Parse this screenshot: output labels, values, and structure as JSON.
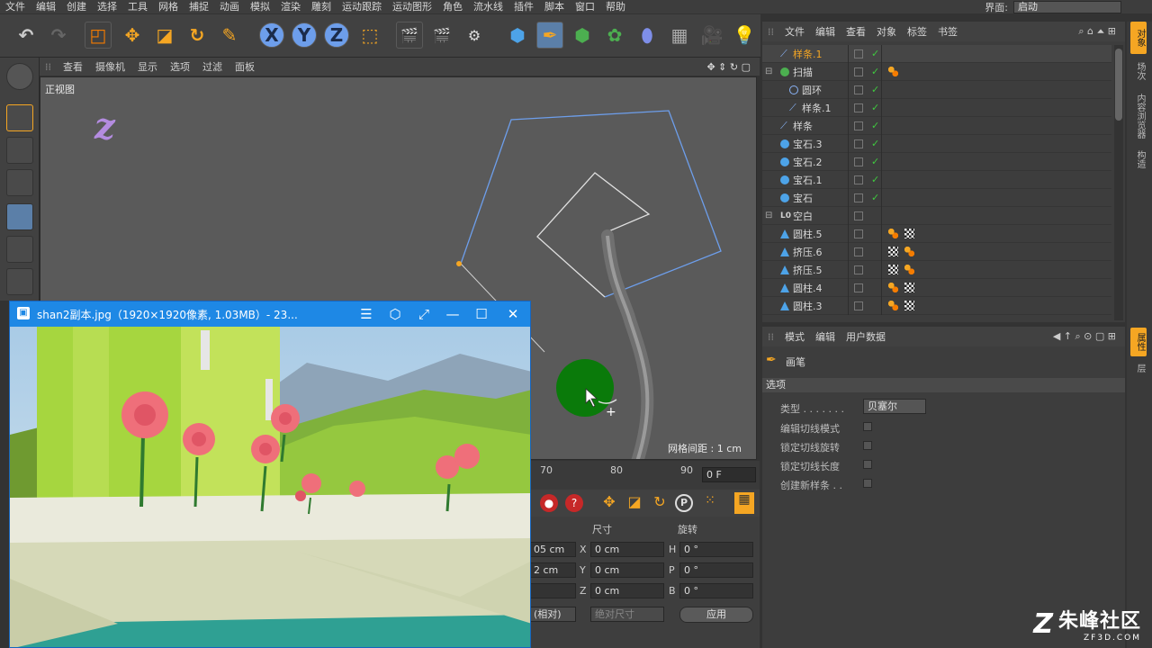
{
  "menubar": {
    "items": [
      "文件",
      "编辑",
      "创建",
      "选择",
      "工具",
      "网格",
      "捕捉",
      "动画",
      "模拟",
      "渲染",
      "雕刻",
      "运动跟踪",
      "运动图形",
      "角色",
      "流水线",
      "插件",
      "脚本",
      "窗口",
      "帮助"
    ],
    "interface_label": "界面:",
    "interface_value": "启动"
  },
  "viewport": {
    "menu": [
      "查看",
      "摄像机",
      "显示",
      "选项",
      "过滤",
      "面板"
    ],
    "view_name": "正视图",
    "grid_spacing": "网格间距 : 1 cm"
  },
  "timeline": {
    "ticks": [
      "70",
      "80",
      "90"
    ],
    "frame": "0 F"
  },
  "coords": {
    "headers": {
      "size": "尺寸",
      "rotation": "旋转"
    },
    "pos": [
      "05 cm",
      "2 cm",
      ""
    ],
    "size_labels": [
      "X",
      "Y",
      "Z"
    ],
    "size_vals": [
      "0 cm",
      "0 cm",
      "0 cm"
    ],
    "rot_labels": [
      "H",
      "P",
      "B"
    ],
    "rot_vals": [
      "0 °",
      "0 °",
      "0 °"
    ],
    "mode1": "(相对)",
    "mode2": "绝对尺寸",
    "apply": "应用"
  },
  "objects": {
    "menu": [
      "文件",
      "编辑",
      "查看",
      "对象",
      "标签",
      "书签"
    ],
    "rows": [
      {
        "name": "样条.1",
        "indent": 0,
        "selected": true,
        "icon": "spline",
        "color": "#8ab4f8",
        "tags": []
      },
      {
        "name": "扫描",
        "indent": 0,
        "selected": false,
        "icon": "sweep",
        "color": "#4caf50",
        "tags": [
          "dots"
        ]
      },
      {
        "name": "圆环",
        "indent": 1,
        "selected": false,
        "icon": "circle",
        "color": "#8ab4f8",
        "tags": []
      },
      {
        "name": "样条.1",
        "indent": 1,
        "selected": false,
        "icon": "spline",
        "color": "#8ab4f8",
        "tags": []
      },
      {
        "name": "样条",
        "indent": 0,
        "selected": false,
        "icon": "spline",
        "color": "#8ab4f8",
        "tags": []
      },
      {
        "name": "宝石.3",
        "indent": 0,
        "selected": false,
        "icon": "gem",
        "color": "#4da3e8",
        "tags": []
      },
      {
        "name": "宝石.2",
        "indent": 0,
        "selected": false,
        "icon": "gem",
        "color": "#4da3e8",
        "tags": []
      },
      {
        "name": "宝石.1",
        "indent": 0,
        "selected": false,
        "icon": "gem",
        "color": "#4da3e8",
        "tags": []
      },
      {
        "name": "宝石",
        "indent": 0,
        "selected": false,
        "icon": "gem",
        "color": "#4da3e8",
        "tags": []
      },
      {
        "name": "空白",
        "indent": 0,
        "selected": false,
        "icon": "null",
        "color": "#cfcfcf",
        "tags": []
      },
      {
        "name": "圆柱.5",
        "indent": 0,
        "selected": false,
        "icon": "cone",
        "color": "#4da3e8",
        "tags": [
          "dots",
          "checker"
        ]
      },
      {
        "name": "挤压.6",
        "indent": 0,
        "selected": false,
        "icon": "cone",
        "color": "#4da3e8",
        "tags": [
          "checker",
          "dots"
        ]
      },
      {
        "name": "挤压.5",
        "indent": 0,
        "selected": false,
        "icon": "cone",
        "color": "#4da3e8",
        "tags": [
          "checker",
          "dots"
        ]
      },
      {
        "name": "圆柱.4",
        "indent": 0,
        "selected": false,
        "icon": "cone",
        "color": "#4da3e8",
        "tags": [
          "dots",
          "checker"
        ]
      },
      {
        "name": "圆柱.3",
        "indent": 0,
        "selected": false,
        "icon": "cone",
        "color": "#4da3e8",
        "tags": [
          "dots",
          "checker"
        ]
      }
    ]
  },
  "attributes": {
    "menu": [
      "模式",
      "编辑",
      "用户数据"
    ],
    "tool_name": "画笔",
    "section": "选项",
    "type_label": "类型 . . . . . . .",
    "type_value": "贝塞尔",
    "options": [
      "编辑切线模式",
      "锁定切线旋转",
      "锁定切线长度",
      "创建新样条 . ."
    ]
  },
  "right_tabs": [
    "对象",
    "场次",
    "内容浏览器",
    "构造",
    "属性",
    "层"
  ],
  "image_viewer": {
    "title": "shan2副本.jpg（1920×1920像素, 1.03MB）- 23..."
  },
  "watermark": {
    "name": "朱峰社区",
    "url": "ZF3D.COM"
  },
  "colors": {
    "accent": "#f5a623",
    "viewer_blue": "#1e88e5",
    "spline_blue": "#6d9eeb",
    "active_green": "#0a7a0a"
  }
}
